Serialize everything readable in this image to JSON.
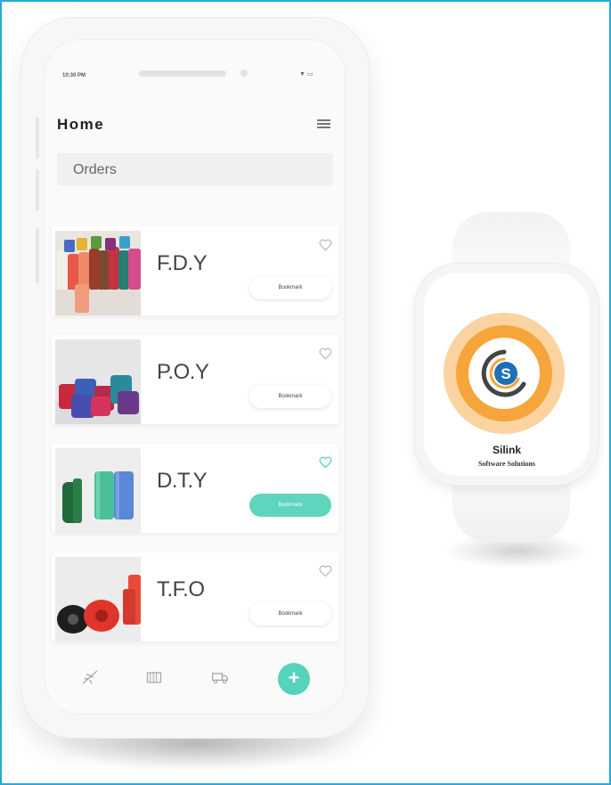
{
  "phone": {
    "status_time": "10:30 PM",
    "header": {
      "title": "Home",
      "menu_icon": "hamburger-menu-icon"
    },
    "orders_label": "Orders",
    "products": [
      {
        "title": "F.D.Y",
        "bookmark_label": "Bookmark",
        "favorited": false,
        "thumb_icon": "yarn-spools-image"
      },
      {
        "title": "P.O.Y",
        "bookmark_label": "Bookmark",
        "favorited": false,
        "thumb_icon": "yarn-spools-image"
      },
      {
        "title": "D.T.Y",
        "bookmark_label": "Bookmark",
        "favorited": true,
        "thumb_icon": "yarn-spools-image"
      },
      {
        "title": "T.F.O",
        "bookmark_label": "Bookmark",
        "favorited": false,
        "thumb_icon": "yarn-spools-image"
      }
    ],
    "bottom_nav": [
      {
        "icon": "airplane-icon"
      },
      {
        "icon": "shipping-container-icon"
      },
      {
        "icon": "truck-icon"
      },
      {
        "icon": "plus-icon",
        "label": "+"
      }
    ]
  },
  "watch": {
    "brand": "Silink",
    "tagline": "Software Solutions",
    "logo_letter": "S"
  },
  "colors": {
    "accent": "#56d3bb",
    "frame_border": "#2aa7df",
    "logo_orange": "#f5a53a",
    "logo_light_orange": "#fbd3a0",
    "logo_blue": "#1f6fb5"
  }
}
